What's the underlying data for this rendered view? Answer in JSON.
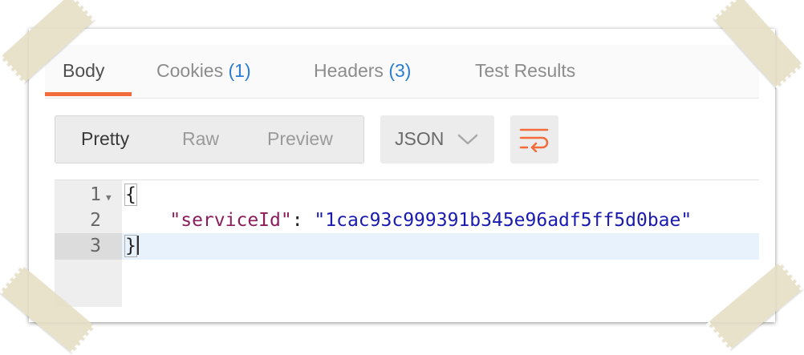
{
  "tabs": [
    {
      "label": "Body",
      "count": "",
      "active": true
    },
    {
      "label": "Cookies",
      "count": "(1)",
      "active": false
    },
    {
      "label": "Headers",
      "count": "(3)",
      "active": false
    },
    {
      "label": "Test Results",
      "count": "",
      "active": false
    }
  ],
  "view_modes": [
    {
      "label": "Pretty",
      "active": true
    },
    {
      "label": "Raw",
      "active": false
    },
    {
      "label": "Preview",
      "active": false
    }
  ],
  "format_select": {
    "value": "JSON",
    "icon": "chevron-down-icon"
  },
  "wrap_button": {
    "icon": "wrap-lines-icon"
  },
  "editor": {
    "lines": [
      {
        "number": "1",
        "foldable": true,
        "open": "{"
      },
      {
        "number": "2",
        "foldable": false,
        "key": "\"serviceId\"",
        "sep": ": ",
        "value": "\"1cac93c999391b345e96adf5ff5d0bae\""
      },
      {
        "number": "3",
        "foldable": false,
        "close": "}"
      }
    ]
  },
  "colors": {
    "accent": "#f26b3a",
    "count": "#2b7cd3",
    "json_key": "#8a1e5a",
    "json_string": "#1a1ab0",
    "active_line": "#e8f2fd"
  }
}
